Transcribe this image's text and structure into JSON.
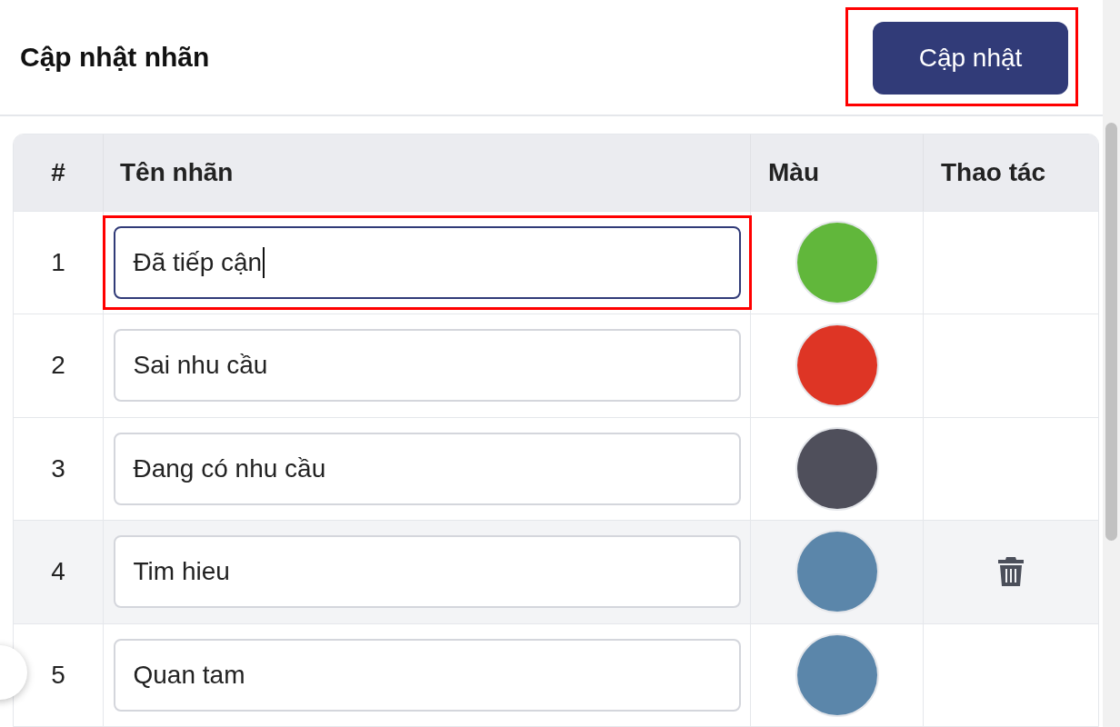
{
  "header": {
    "title": "Cập nhật nhãn",
    "button": {
      "label": "Cập nhật",
      "highlighted": true
    }
  },
  "table": {
    "columns": [
      "#",
      "Tên nhãn",
      "Màu",
      "Thao tác"
    ],
    "rows": [
      {
        "index": "1",
        "name": "Đã tiếp cận",
        "color": "#61b73b",
        "focused": true,
        "highlighted": true,
        "hovered": false
      },
      {
        "index": "2",
        "name": "Sai nhu cầu",
        "color": "#de3525",
        "focused": false,
        "highlighted": false,
        "hovered": false
      },
      {
        "index": "3",
        "name": "Đang có nhu cầu",
        "color": "#4f4f5b",
        "focused": false,
        "highlighted": false,
        "hovered": false
      },
      {
        "index": "4",
        "name": "Tim hieu",
        "color": "#5b86aa",
        "focused": false,
        "highlighted": false,
        "hovered": true
      },
      {
        "index": "5",
        "name": "Quan tam",
        "color": "#5b86aa",
        "focused": false,
        "highlighted": false,
        "hovered": false
      }
    ]
  }
}
